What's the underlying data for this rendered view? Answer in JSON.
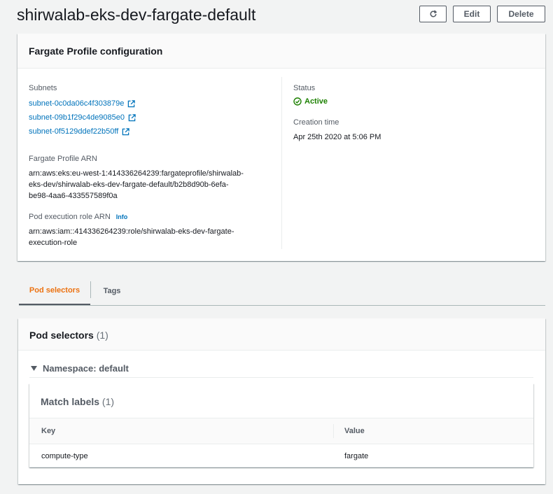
{
  "page": {
    "title": "shirwalab-eks-dev-fargate-default"
  },
  "actions": {
    "refresh_icon": "refresh-icon",
    "edit_label": "Edit",
    "delete_label": "Delete"
  },
  "config": {
    "header": "Fargate Profile configuration",
    "subnets_label": "Subnets",
    "subnets": [
      "subnet-0c0da06c4f303879e",
      "subnet-09b1f29c4de9085e0",
      "subnet-0f5129ddef22b50ff"
    ],
    "arn_label": "Fargate Profile ARN",
    "arn_lines": [
      "arn:aws:eks:eu-west-1:414336264239:fargateprofile/shirwalab-",
      "eks-dev/shirwalab-eks-dev-fargate-default/b2b8d90b-6efa-",
      "be98-4aa6-433557589f0a"
    ],
    "role_label": "Pod execution role ARN",
    "role_info": "Info",
    "role_lines": [
      "arn:aws:iam::414336264239:role/shirwalab-eks-dev-fargate-",
      "execution-role"
    ],
    "status_label": "Status",
    "status_value": "Active",
    "creation_label": "Creation time",
    "creation_value": "Apr 25th 2020 at 5:06 PM"
  },
  "tabs": [
    {
      "label": "Pod selectors",
      "active": true
    },
    {
      "label": "Tags",
      "active": false
    }
  ],
  "pod_selectors": {
    "header": "Pod selectors",
    "count": "(1)",
    "namespace_label": "Namespace: default",
    "match_labels_header": "Match labels",
    "match_labels_count": "(1)",
    "columns": [
      "Key",
      "Value"
    ],
    "rows": [
      {
        "key": "compute-type",
        "value": "fargate"
      }
    ]
  },
  "colors": {
    "accent_orange": "#ec7211",
    "link_blue": "#0073bb",
    "status_green": "#1d8102"
  }
}
